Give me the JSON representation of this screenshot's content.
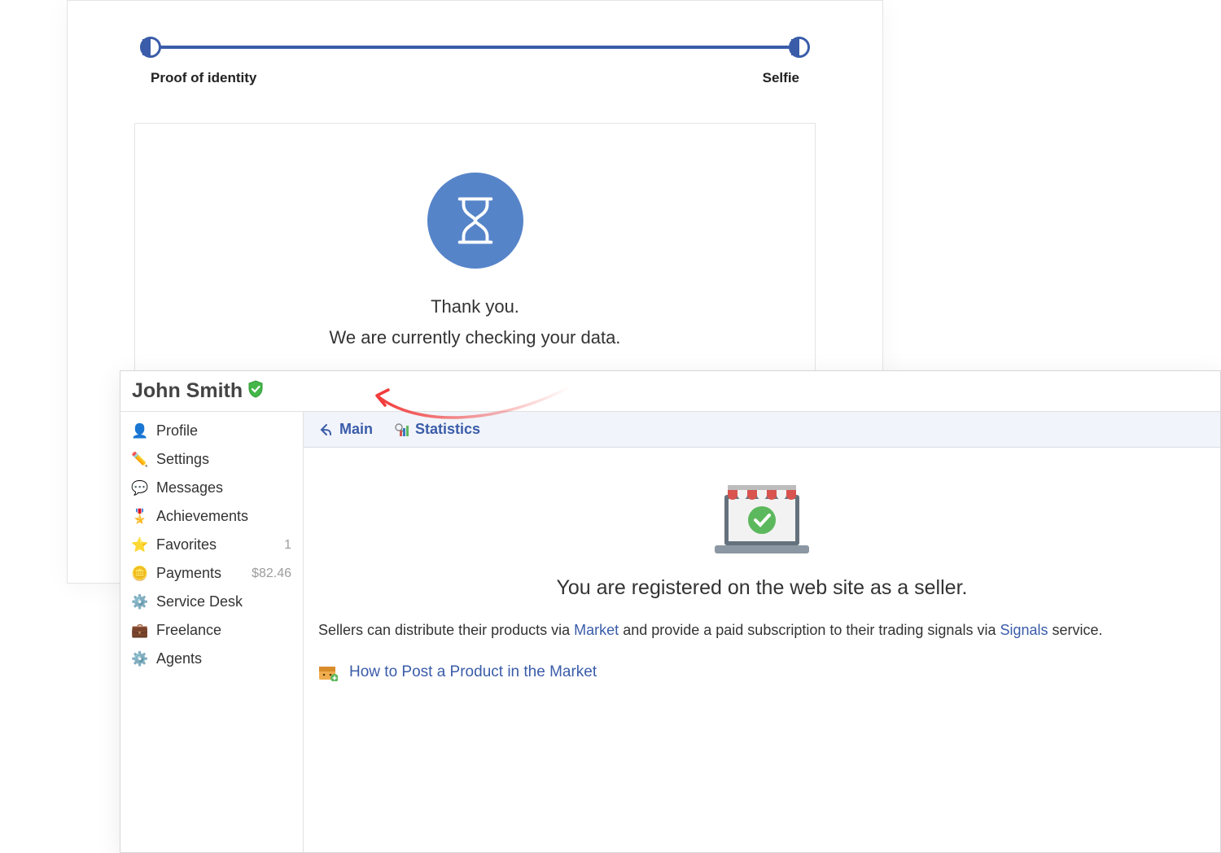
{
  "verification": {
    "step_left": "Proof of identity",
    "step_right": "Selfie",
    "status_line1": "Thank you.",
    "status_line2": "We are currently checking your data."
  },
  "profile": {
    "user_name": "John Smith",
    "sidebar": [
      {
        "icon": "person-icon",
        "label": "Profile",
        "meta": ""
      },
      {
        "icon": "pencil-icon",
        "label": "Settings",
        "meta": ""
      },
      {
        "icon": "bubbles-icon",
        "label": "Messages",
        "meta": ""
      },
      {
        "icon": "medal-icon",
        "label": "Achievements",
        "meta": ""
      },
      {
        "icon": "star-icon",
        "label": "Favorites",
        "meta": "1"
      },
      {
        "icon": "coins-icon",
        "label": "Payments",
        "meta": "$82.46"
      },
      {
        "icon": "gear-icon",
        "label": "Service Desk",
        "meta": ""
      },
      {
        "icon": "briefcase-icon",
        "label": "Freelance",
        "meta": ""
      },
      {
        "icon": "cog-icon",
        "label": "Agents",
        "meta": ""
      }
    ],
    "tabs": {
      "main": "Main",
      "statistics": "Statistics"
    },
    "seller_block": {
      "headline": "You are registered on the web site as a seller.",
      "desc_pre": "Sellers can distribute their products via ",
      "link_market": "Market",
      "desc_mid": " and provide a paid subscription to their trading signals via ",
      "link_signals": "Signals",
      "desc_post": " service.",
      "howto": "How to Post a Product in the Market"
    }
  }
}
